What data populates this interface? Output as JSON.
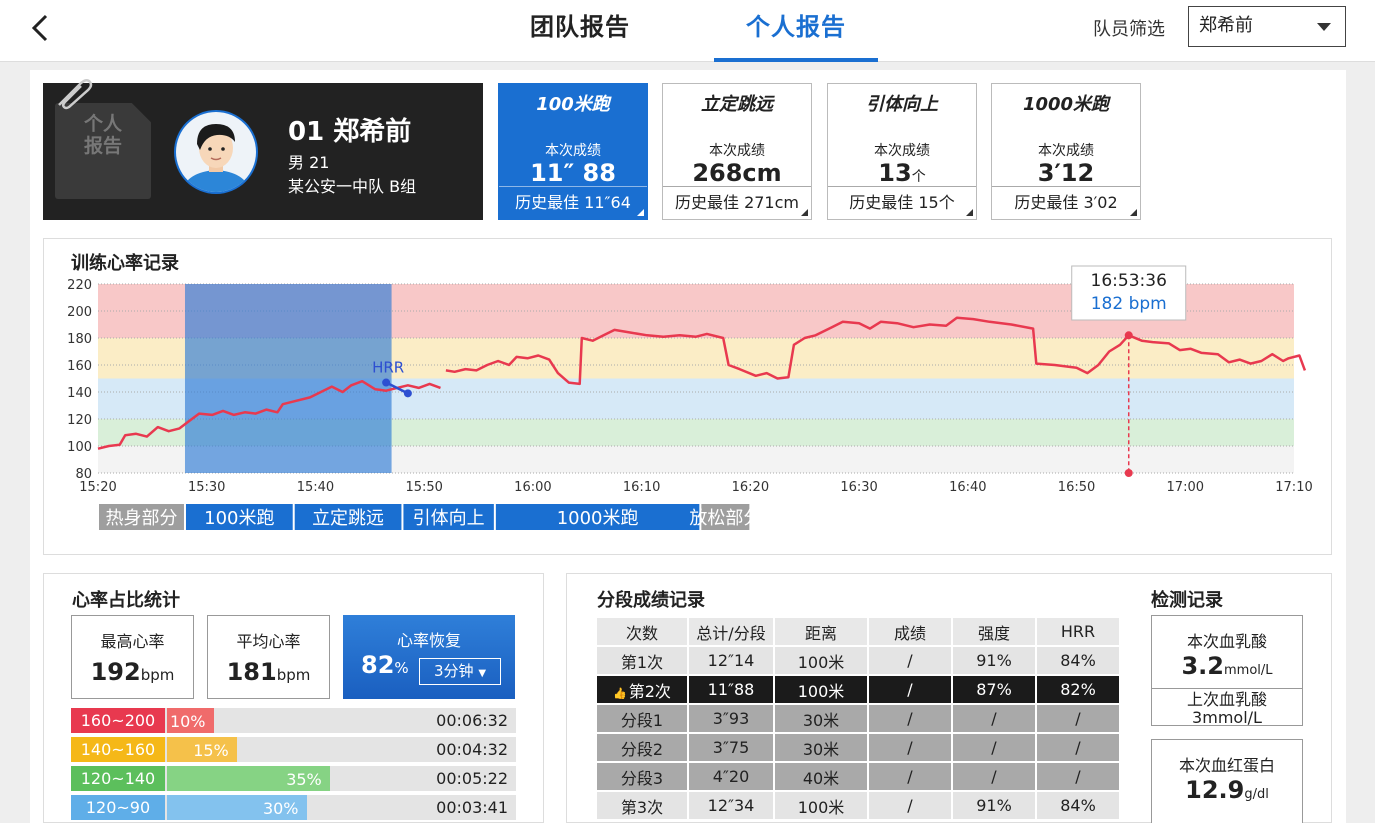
{
  "header": {
    "tabs": [
      {
        "label": "团队报告"
      },
      {
        "label": "个人报告"
      }
    ],
    "filter_label": "队员筛选",
    "filter_value": "郑希前"
  },
  "profile": {
    "stamp_text": "个人\n报告",
    "number_name": "01 郑希前",
    "gender_age": "男  21",
    "team": "某公安一中队 B组"
  },
  "score_cards": [
    {
      "title": "100米跑",
      "label": "本次成绩",
      "value": "11″ 88",
      "unit": "",
      "best": "历史最佳 11″64",
      "active": true
    },
    {
      "title": "立定跳远",
      "label": "本次成绩",
      "value": "268cm",
      "unit": "",
      "best": "历史最佳 271cm",
      "active": false
    },
    {
      "title": "引体向上",
      "label": "本次成绩",
      "value": "13",
      "unit": "个",
      "best": "历史最佳 15个",
      "active": false
    },
    {
      "title": "1000米跑",
      "label": "本次成绩",
      "value": "3′12",
      "unit": "",
      "best": "历史最佳 3′02",
      "active": false
    }
  ],
  "hr_section_title": "训练心率记录",
  "chart_data": {
    "type": "line",
    "title": "训练心率记录",
    "x_ticks": [
      "15:20",
      "15:30",
      "15:40",
      "15:50",
      "16:00",
      "16:10",
      "16:20",
      "16:30",
      "16:40",
      "16:50",
      "17:00",
      "17:10"
    ],
    "y_ticks": [
      80,
      100,
      120,
      140,
      160,
      180,
      200,
      220
    ],
    "ylim": [
      80,
      220
    ],
    "xlim_min": [
      920,
      1030
    ],
    "zones": [
      {
        "from": 80,
        "to": 100,
        "color": "#f3f3f3"
      },
      {
        "from": 100,
        "to": 120,
        "color": "#d9efd9"
      },
      {
        "from": 120,
        "to": 150,
        "color": "#d6e9f7"
      },
      {
        "from": 150,
        "to": 180,
        "color": "#fbedc6"
      },
      {
        "from": 180,
        "to": 220,
        "color": "#f8c8c8"
      }
    ],
    "highlight_range_min": [
      928,
      947
    ],
    "series": [
      {
        "color": "#e8394f",
        "points": [
          [
            920,
            98
          ],
          [
            921,
            100
          ],
          [
            922,
            101
          ],
          [
            922.5,
            108
          ],
          [
            923.5,
            109
          ],
          [
            924.5,
            107
          ],
          [
            925.5,
            114
          ],
          [
            926.5,
            111
          ],
          [
            927.5,
            113
          ],
          [
            928.3,
            118
          ],
          [
            929.3,
            124
          ],
          [
            930.5,
            123
          ],
          [
            931.5,
            126
          ],
          [
            932.5,
            123
          ],
          [
            933.5,
            125
          ],
          [
            934.5,
            124
          ],
          [
            935.5,
            127
          ],
          [
            936.5,
            125
          ],
          [
            937,
            131
          ],
          [
            938,
            133
          ],
          [
            939.5,
            136
          ],
          [
            940.5,
            140
          ],
          [
            941.5,
            144
          ],
          [
            942.5,
            140
          ],
          [
            943.3,
            145
          ],
          [
            944.3,
            148
          ],
          [
            945.5,
            142
          ],
          [
            946.5,
            141
          ],
          [
            947.5,
            143
          ],
          [
            948.5,
            145
          ],
          [
            949.5,
            143
          ],
          [
            950.5,
            146
          ],
          [
            951.5,
            143
          ]
        ]
      },
      {
        "color": "#e8394f",
        "points": [
          [
            952,
            156
          ],
          [
            952.8,
            155
          ],
          [
            953.8,
            157
          ],
          [
            954.8,
            156
          ],
          [
            955.8,
            160
          ],
          [
            956.8,
            163
          ],
          [
            957.8,
            160
          ],
          [
            958.5,
            166
          ],
          [
            959.5,
            165
          ],
          [
            960.5,
            167
          ],
          [
            961.5,
            164
          ],
          [
            962.3,
            154
          ],
          [
            963.3,
            147
          ],
          [
            964.3,
            146
          ],
          [
            964.5,
            180
          ],
          [
            965.5,
            178
          ],
          [
            966.5,
            182
          ],
          [
            967.5,
            186
          ],
          [
            969,
            184
          ],
          [
            970.5,
            182
          ],
          [
            972,
            181
          ],
          [
            973.5,
            182
          ],
          [
            975,
            181
          ],
          [
            976,
            183
          ],
          [
            977.5,
            180
          ],
          [
            978,
            160
          ],
          [
            979,
            157
          ],
          [
            980.5,
            152
          ],
          [
            981.5,
            154
          ],
          [
            982.5,
            150
          ],
          [
            983.5,
            151
          ],
          [
            984,
            175
          ],
          [
            985,
            180
          ],
          [
            986,
            182
          ],
          [
            987.5,
            188
          ],
          [
            988.5,
            192
          ],
          [
            990,
            191
          ],
          [
            991,
            187
          ],
          [
            992,
            192
          ],
          [
            993.5,
            191
          ],
          [
            995,
            188
          ],
          [
            996.5,
            190
          ],
          [
            998,
            189
          ],
          [
            999,
            195
          ],
          [
            1000.5,
            194
          ],
          [
            1002,
            192
          ],
          [
            1004,
            190
          ],
          [
            1006,
            187
          ],
          [
            1006.3,
            161
          ],
          [
            1008,
            160
          ],
          [
            1010,
            158
          ],
          [
            1011,
            154
          ],
          [
            1012,
            160
          ],
          [
            1013,
            170
          ],
          [
            1014,
            175
          ],
          [
            1014.8,
            182
          ],
          [
            1016,
            178
          ],
          [
            1017,
            177
          ],
          [
            1018.5,
            176
          ],
          [
            1019.5,
            171
          ],
          [
            1020.5,
            172
          ],
          [
            1021.5,
            169
          ],
          [
            1023,
            168
          ],
          [
            1024,
            162
          ],
          [
            1025,
            164
          ],
          [
            1026,
            161
          ],
          [
            1027,
            163
          ],
          [
            1028,
            168
          ],
          [
            1029,
            163
          ],
          [
            1029.5,
            165
          ],
          [
            1030.5,
            167
          ],
          [
            1031,
            156
          ]
        ]
      }
    ],
    "hrr_label": "HRR",
    "hrr_points": [
      [
        946.5,
        147
      ],
      [
        948.5,
        139
      ]
    ],
    "marker": {
      "time": "16:53:36",
      "value": "182 bpm",
      "x_min": 1014.8,
      "y": 182
    },
    "phases": [
      {
        "label": "热身部分",
        "from": 920,
        "to": 928,
        "color": "#9e9e9e"
      },
      {
        "label": "100米跑",
        "from": 928,
        "to": 938,
        "color": "#1a6fd1"
      },
      {
        "label": "立定跳远",
        "from": 938,
        "to": 948,
        "color": "#1a6fd1"
      },
      {
        "label": "引体向上",
        "from": 948,
        "to": 956.5,
        "color": "#1a6fd1"
      },
      {
        "label": "1000米跑",
        "from": 956.5,
        "to": 975.4,
        "color": "#1a6fd1"
      },
      {
        "label": "放松部分",
        "from": 975.4,
        "to": 980,
        "color": "#9e9e9e"
      }
    ]
  },
  "hr_stats": {
    "title": "心率占比统计",
    "max": {
      "label": "最高心率",
      "value": "192",
      "unit": "bpm"
    },
    "avg": {
      "label": "平均心率",
      "value": "181",
      "unit": "bpm"
    },
    "recovery": {
      "label": "心率恢复",
      "value": "82",
      "unit": "%",
      "select": "3分钟"
    },
    "zones": [
      {
        "label": "160~200",
        "percent_text": "10%",
        "percent": 10,
        "time": "00:06:32",
        "label_color": "#e8394f",
        "bar_color": "#f06b6b"
      },
      {
        "label": "140~160",
        "percent_text": "15%",
        "percent": 15,
        "time": "00:04:32",
        "label_color": "#f5b818",
        "bar_color": "#f5c14a"
      },
      {
        "label": "120~140",
        "percent_text": "35%",
        "percent": 35,
        "time": "00:05:22",
        "label_color": "#5cbf5c",
        "bar_color": "#86d384"
      },
      {
        "label": "120~90",
        "percent_text": "30%",
        "percent": 30,
        "time": "00:03:41",
        "label_color": "#5faee8",
        "bar_color": "#83c2ee"
      }
    ]
  },
  "segments": {
    "title": "分段成绩记录",
    "columns": [
      "次数",
      "总计/分段",
      "距离",
      "成绩",
      "强度",
      "HRR"
    ],
    "rows": [
      {
        "cells": [
          "第1次",
          "12″14",
          "100米",
          "/",
          "91%",
          "84%"
        ],
        "style": "light"
      },
      {
        "cells": [
          "第2次",
          "11″88",
          "100米",
          "/",
          "87%",
          "82%"
        ],
        "style": "dark",
        "best": true
      },
      {
        "cells": [
          "分段1",
          "3″93",
          "30米",
          "/",
          "/",
          "/"
        ],
        "style": "grey"
      },
      {
        "cells": [
          "分段2",
          "3″75",
          "30米",
          "/",
          "/",
          "/"
        ],
        "style": "grey"
      },
      {
        "cells": [
          "分段3",
          "4″20",
          "40米",
          "/",
          "/",
          "/"
        ],
        "style": "grey"
      },
      {
        "cells": [
          "第3次",
          "12″34",
          "100米",
          "/",
          "91%",
          "84%"
        ],
        "style": "light"
      }
    ]
  },
  "tests": {
    "title": "检测记录",
    "lactate_now": {
      "label": "本次血乳酸",
      "value": "3.2",
      "unit": "mmol/L"
    },
    "lactate_prev": {
      "label": "上次血乳酸",
      "value": "3mmol/L"
    },
    "hb_now": {
      "label": "本次血红蛋白",
      "value": "12.9",
      "unit": "g/dl"
    }
  }
}
